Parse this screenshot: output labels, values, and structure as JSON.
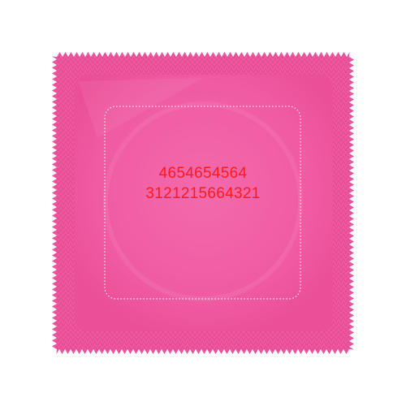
{
  "packet": {
    "color": "#f0579f",
    "edge_color": "#e94d96",
    "highlight_color": "#f786bc",
    "inner_border_color": "#ffffff",
    "text_color": "#ff1a1a"
  },
  "codes": {
    "line_1": "4654654564",
    "line_2": "3121215664321"
  }
}
